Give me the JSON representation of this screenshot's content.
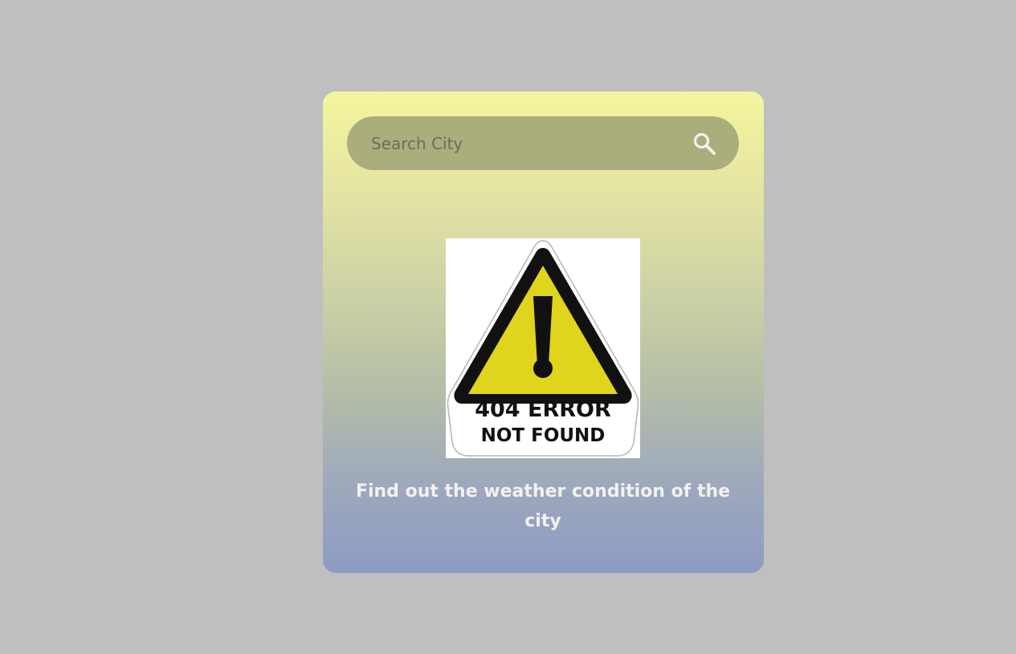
{
  "search": {
    "placeholder": "Search City",
    "value": "",
    "icon": "search-icon"
  },
  "error_image": {
    "line1": "404 ERROR",
    "line2": "NOT FOUND",
    "icon": "warning-triangle-icon"
  },
  "caption": "Find out the weather condition of the city",
  "colors": {
    "page_background": "#bfbfbf",
    "card_gradient_top": "#f5f59e",
    "card_gradient_bottom": "#8c9bc3",
    "search_bar": "#abad7c",
    "warning_yellow": "#e0d41c",
    "caption_text": "#f2f2ef"
  }
}
